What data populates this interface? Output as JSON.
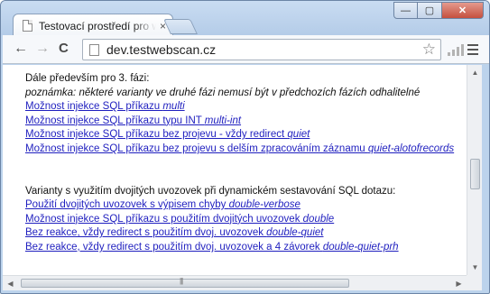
{
  "browser": {
    "tab_title": "Testovací prostředí pro w",
    "tab_close": "×",
    "url": "dev.testwebscan.cz",
    "back": "←",
    "forward": "→",
    "reload": "C",
    "star": "☆",
    "window_minimize": "—",
    "window_maximize": "▢",
    "window_close": "✕"
  },
  "page": {
    "intro": "Dále především pro 3. fázi:",
    "note": "poznámka: některé varianty ve druhé fázi nemusí být v předchozích fázích odhalitelné",
    "links_a": [
      {
        "text": "Možnost injekce SQL příkazu ",
        "tag": "multi"
      },
      {
        "text": "Možnost injekce SQL příkazu typu INT ",
        "tag": "multi-int"
      },
      {
        "text": "Možnost injekce SQL příkazu bez projevu - vždy redirect ",
        "tag": "quiet"
      },
      {
        "text": "Možnost injekce SQL příkazu bez projevu s delším zpracováním záznamu ",
        "tag": "quiet-alotofrecords"
      }
    ],
    "section2": "Varianty s využitím dvojitých uvozovek při dynamickém sestavování SQL dotazu:",
    "links_b": [
      {
        "text": "Použití dvojitých uvozovek s výpisem chyby ",
        "tag": "double-verbose"
      },
      {
        "text": "Možnost injekce SQL příkazu s použitím dvojitých uvozovek ",
        "tag": "double"
      },
      {
        "text": "Bez reakce, vždy redirect s použitím dvoj. uvozovek ",
        "tag": "double-quiet"
      },
      {
        "text": "Bez reakce, vždy redirect s použitím dvoj. uvozovek a 4 závorek ",
        "tag": "double-quiet-prh"
      }
    ]
  }
}
